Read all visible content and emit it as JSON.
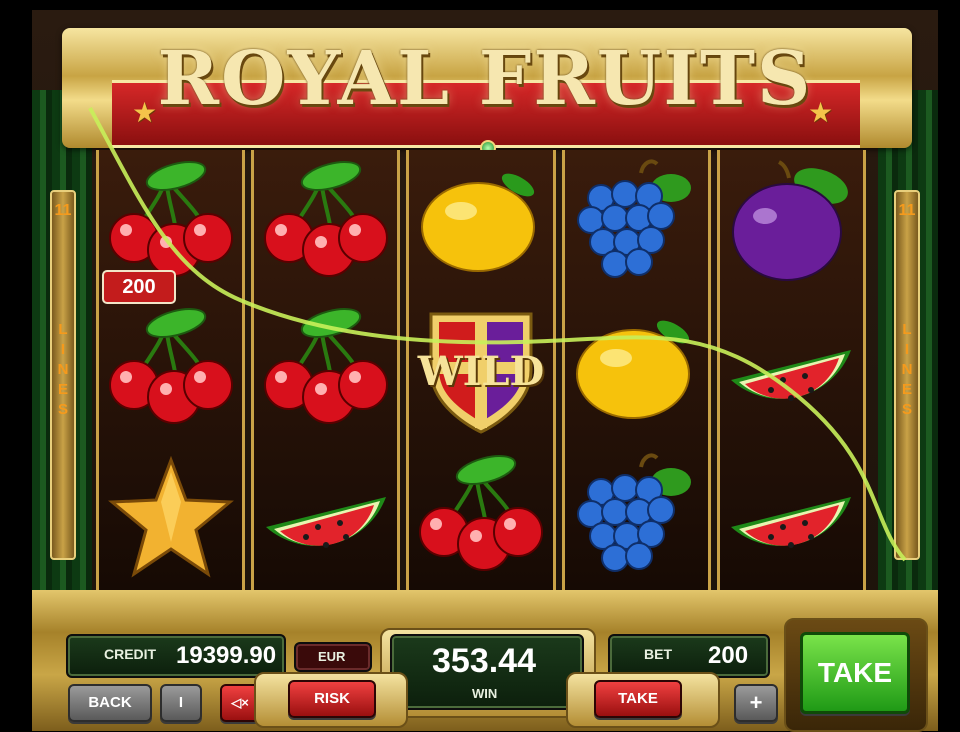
{
  "title": "ROYAL FRUITS",
  "lines": {
    "count": "11",
    "label": "LINES"
  },
  "reels": [
    [
      "cherries",
      "cherries",
      "star"
    ],
    [
      "cherries",
      "cherries",
      "watermelon"
    ],
    [
      "lemon",
      "wild",
      "cherries"
    ],
    [
      "grapes",
      "lemon",
      "grapes"
    ],
    [
      "plum",
      "watermelon",
      "watermelon"
    ]
  ],
  "wild_label": "WILD",
  "line_win": "200",
  "credit": {
    "label": "CREDIT",
    "value": "19399.90"
  },
  "currency": "EUR",
  "win": {
    "value": "353.44",
    "label": "WIN"
  },
  "bet": {
    "label": "BET",
    "value": "200"
  },
  "buttons": {
    "back": "BACK",
    "info": "I",
    "mute": "◁×",
    "risk": "RISK",
    "take_small": "TAKE",
    "plus": "+",
    "take_big": "TAKE"
  },
  "colors": {
    "payline": "#c8f05a",
    "take_green": "#2fb324",
    "badge_red": "#c31c1c"
  }
}
